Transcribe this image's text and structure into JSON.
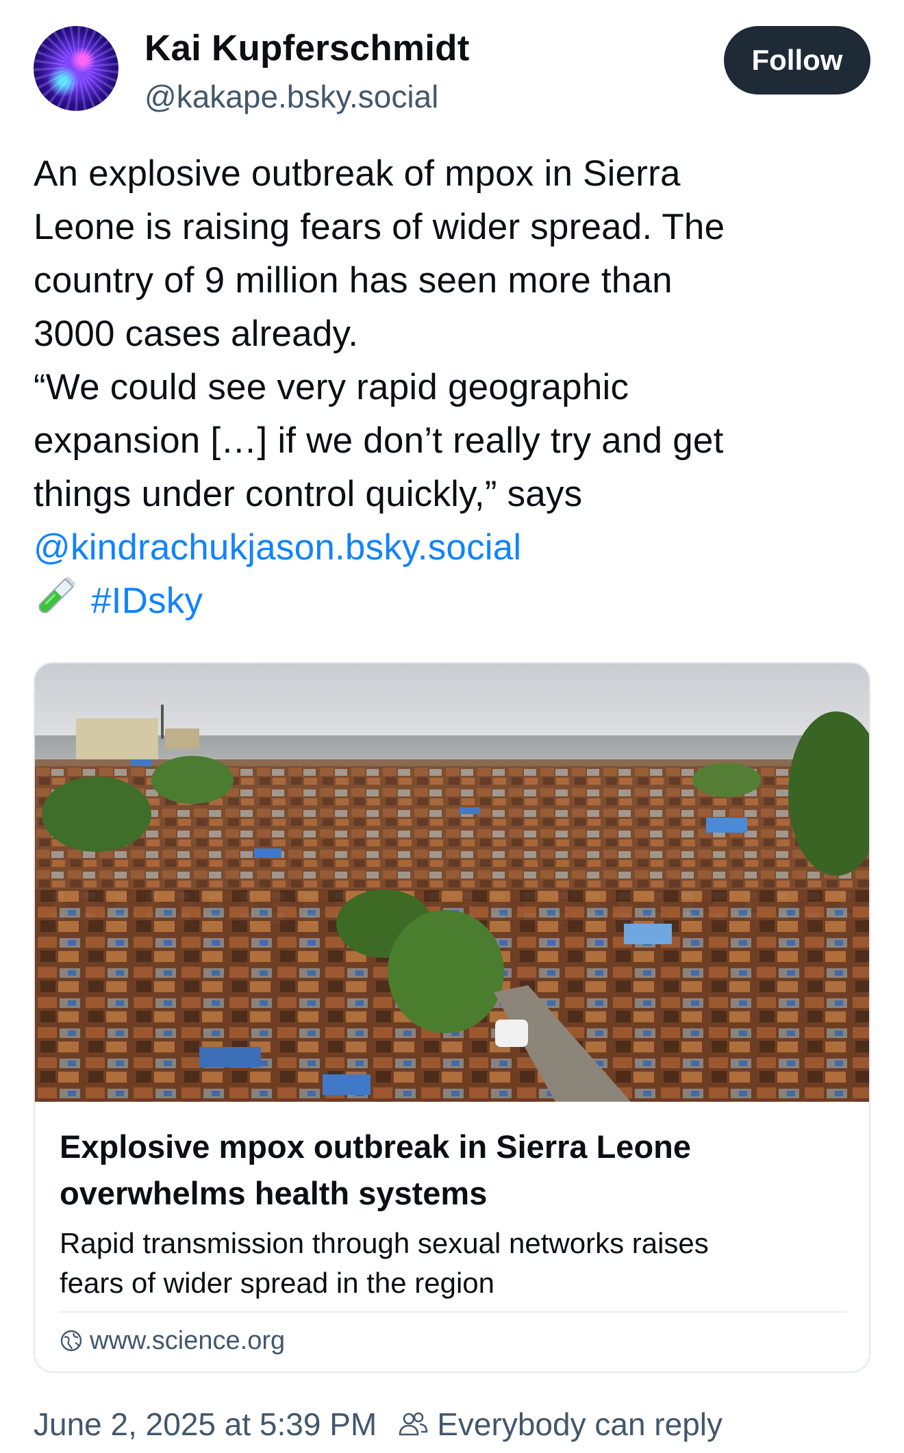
{
  "author": {
    "display_name": "Kai Kupferschmidt",
    "handle": "@kakape.bsky.social",
    "avatar_icon": "avatar-image"
  },
  "follow_button": {
    "label": "Follow"
  },
  "post": {
    "lines": [
      "An explosive outbreak of mpox in Sierra",
      "Leone is raising fears of wider spread. The",
      "country of 9 million has seen more than",
      "3000 cases already.",
      "“We could see very rapid geographic",
      "expansion […] if we don’t really try and get",
      "things under control quickly,” says"
    ],
    "mention": "@kindrachukjason.bsky.social",
    "emoji_icon": "test-tube-icon",
    "hashtag": "#IDsky"
  },
  "link_card": {
    "image_icon": "sierra-leone-city-aerial-photo",
    "title_lines": [
      "Explosive mpox outbreak in Sierra Leone",
      "overwhelms health systems"
    ],
    "description_lines": [
      "Rapid transmission through sexual networks raises",
      "fears of wider spread in the region"
    ],
    "domain": "www.science.org"
  },
  "footer": {
    "timestamp": "June 2, 2025 at 5:39 PM",
    "reply_setting": "Everybody can reply"
  },
  "colors": {
    "link": "#1083fe",
    "follow_bg": "#1f2a37",
    "secondary_text": "#42576c"
  }
}
